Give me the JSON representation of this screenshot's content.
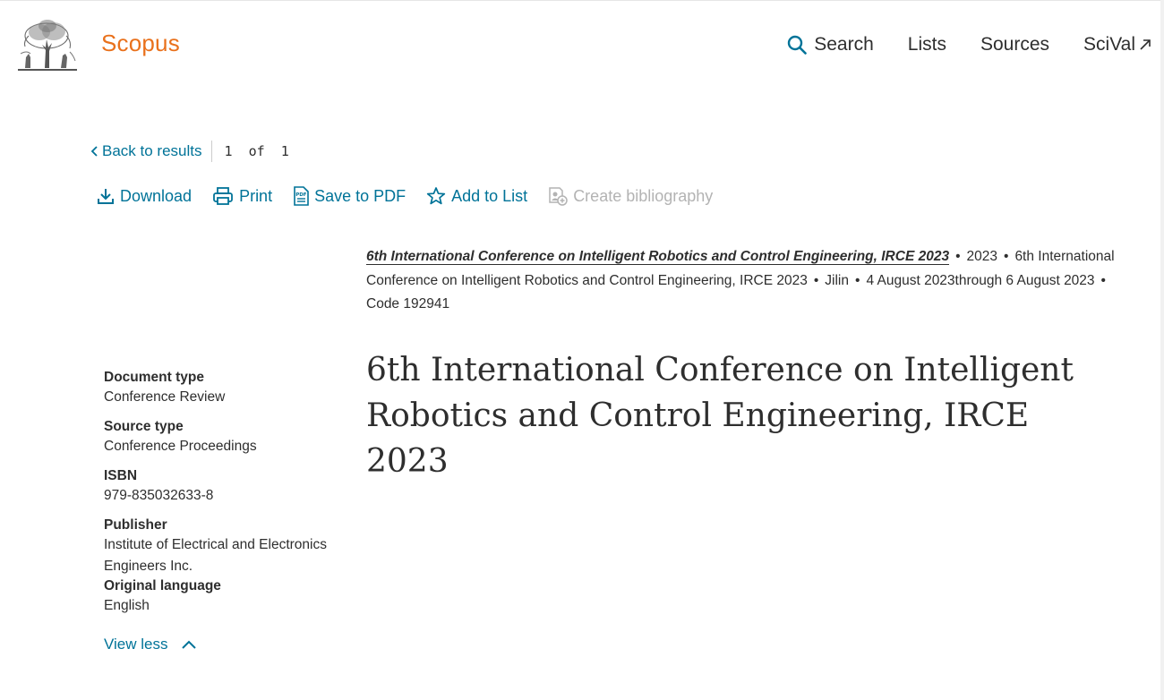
{
  "header": {
    "brand": "Scopus",
    "nav": [
      {
        "label": "Search",
        "icon": "search-icon"
      },
      {
        "label": "Lists"
      },
      {
        "label": "Sources"
      },
      {
        "label": "SciVal",
        "icon": "external-link-icon"
      }
    ]
  },
  "navigation": {
    "back_label": "Back to results",
    "pager": "1  of  1"
  },
  "toolbar": {
    "download": "Download",
    "print": "Print",
    "save_pdf": "Save to PDF",
    "add_list": "Add to List",
    "bibliography": "Create bibliography"
  },
  "source": {
    "title": "6th International Conference on Intelligent Robotics and Control Engineering, IRCE 2023",
    "year": "2023",
    "conference": "6th International Conference on Intelligent Robotics and Control Engineering, IRCE 2023",
    "location": "Jilin",
    "dates": "4 August 2023through 6 August 2023",
    "code": "Code 192941"
  },
  "details": {
    "doc_type_label": "Document type",
    "doc_type": "Conference Review",
    "source_type_label": "Source type",
    "source_type": "Conference Proceedings",
    "isbn_label": "ISBN",
    "isbn": "979-835032633-8",
    "publisher_label": "Publisher",
    "publisher": "Institute of Electrical and Electronics Engineers Inc.",
    "language_label": "Original language",
    "language": "English",
    "view_less": "View less"
  },
  "document": {
    "title": "6th International Conference on Intelligent Robotics and Control Engineering, IRCE 2023"
  },
  "colors": {
    "accent": "#007398",
    "brand": "#e9711c",
    "text": "#2e2e2e",
    "disabled": "#b3b3b3"
  }
}
